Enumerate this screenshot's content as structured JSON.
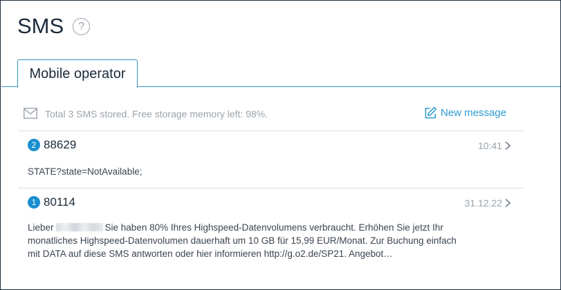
{
  "page": {
    "title": "SMS",
    "help_icon": "?",
    "help_icon_name": "help-circle-icon"
  },
  "tabs": [
    {
      "label": "Mobile operator",
      "active": true
    }
  ],
  "toolbar": {
    "storage_text": "Total 3 SMS stored. Free storage memory left: 98%.",
    "mail_icon_name": "mail-icon",
    "new_message_label": "New message",
    "new_message_icon_name": "edit-icon"
  },
  "messages": [
    {
      "count": "2",
      "sender": "88629",
      "time": "10:41",
      "preview_before": "STATE?state=NotAvailable;",
      "preview_after": "",
      "redacted": false
    },
    {
      "count": "1",
      "sender": "80114",
      "time": "31.12.22",
      "preview_before": "Lieber",
      "preview_after": "Sie haben 80% Ihres Highspeed-Datenvolumens verbraucht. Erhöhen Sie jetzt Ihr monatliches Highspeed-Datenvolumen dauerhaft um 10 GB für 15,99 EUR/Monat. Zur Buchung einfach mit DATA auf diese SMS antworten oder hier informieren http://g.o2.de/SP21. Angebot…",
      "redacted": true
    }
  ],
  "colors": {
    "accent": "#2b9bcf",
    "badge": "#1a8fcf",
    "tab_border": "#2f8fbf",
    "muted_text": "#9aa3ab",
    "title_text": "#1b2a3a"
  }
}
